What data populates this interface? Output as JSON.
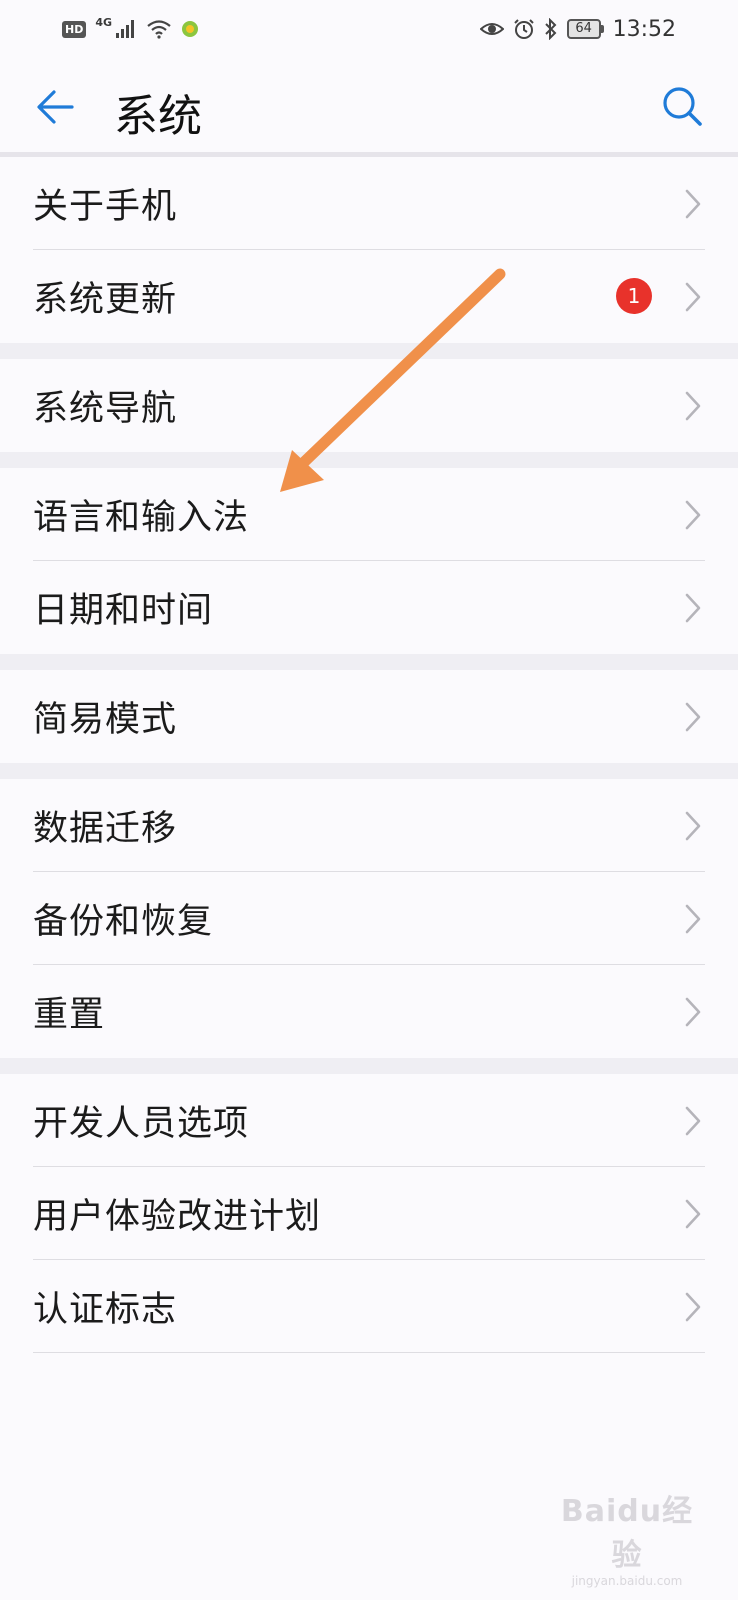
{
  "status_bar": {
    "hd": "HD",
    "network": "4G",
    "battery": "64",
    "time": "13:52"
  },
  "header": {
    "title": "系统"
  },
  "groups": [
    {
      "items": [
        {
          "label": "关于手机"
        },
        {
          "label": "系统更新",
          "badge": "1"
        }
      ]
    },
    {
      "items": [
        {
          "label": "系统导航"
        }
      ]
    },
    {
      "items": [
        {
          "label": "语言和输入法"
        },
        {
          "label": "日期和时间"
        }
      ]
    },
    {
      "items": [
        {
          "label": "简易模式"
        }
      ]
    },
    {
      "items": [
        {
          "label": "数据迁移"
        },
        {
          "label": "备份和恢复"
        },
        {
          "label": "重置"
        }
      ]
    },
    {
      "items": [
        {
          "label": "开发人员选项"
        },
        {
          "label": "用户体验改进计划"
        },
        {
          "label": "认证标志"
        }
      ]
    }
  ],
  "colors": {
    "accent": "#1f7bd8",
    "badge": "#e8322b",
    "annotation_arrow": "#f0904a"
  },
  "icons": {
    "back": "arrow-left-icon",
    "search": "search-icon",
    "chevron": "chevron-right-icon"
  },
  "watermark": {
    "brand": "Baidu经验",
    "url": "jingyan.baidu.com"
  }
}
